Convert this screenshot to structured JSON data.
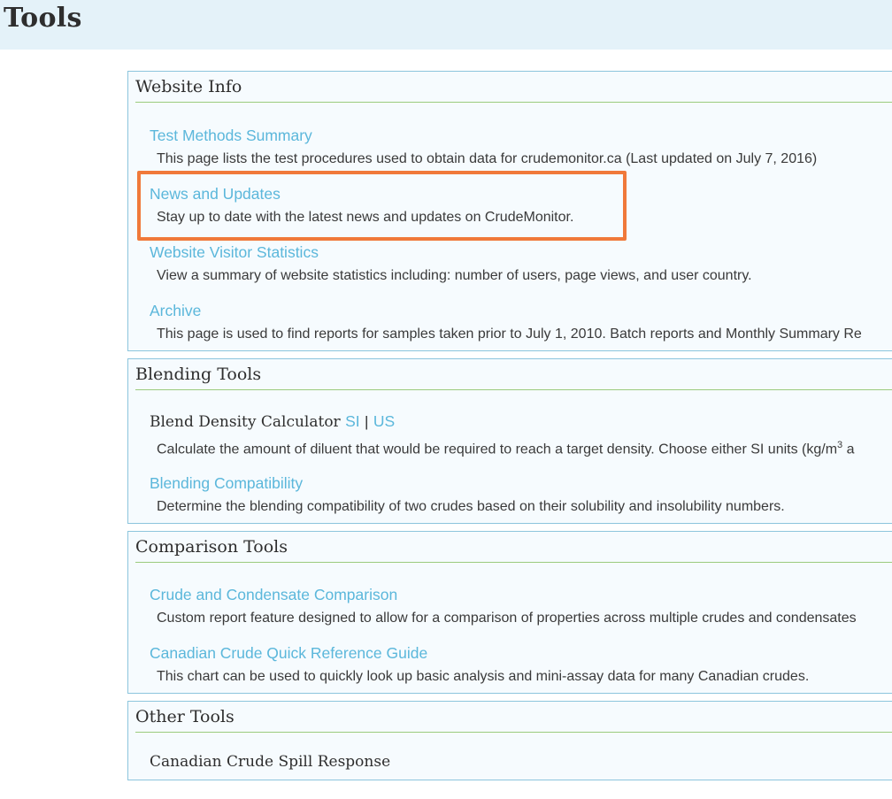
{
  "page": {
    "title": "Tools"
  },
  "sections": {
    "website_info": {
      "heading": "Website Info",
      "items": [
        {
          "link": "Test Methods Summary",
          "description": "This page lists the test procedures used to obtain data for crudemonitor.ca (Last updated on July 7, 2016)"
        },
        {
          "link": "News and Updates",
          "description": "Stay up to date with the latest news and updates on CrudeMonitor."
        },
        {
          "link": "Website Visitor Statistics",
          "description": "View a summary of website statistics including: number of users, page views, and user country."
        },
        {
          "link": "Archive",
          "description": "This page is used to find reports for samples taken prior to July 1, 2010. Batch reports and Monthly Summary Re"
        }
      ]
    },
    "blending_tools": {
      "heading": "Blending Tools",
      "calculator": {
        "title": "Blend Density Calculator",
        "si_link": "SI",
        "separator": "|",
        "us_link": "US",
        "description_pre": "Calculate the amount of diluent that would be required to reach a target density. Choose either SI units (kg/m",
        "description_sup": "3",
        "description_post": " a"
      },
      "items": [
        {
          "link": "Blending Compatibility",
          "description": "Determine the blending compatibility of two crudes based on their solubility and insolubility numbers."
        }
      ]
    },
    "comparison_tools": {
      "heading": "Comparison Tools",
      "items": [
        {
          "link": "Crude and Condensate Comparison",
          "description": "Custom report feature designed to allow for a comparison of properties across multiple crudes and condensates"
        },
        {
          "link": "Canadian Crude Quick Reference Guide",
          "description": "This chart can be used to quickly look up basic analysis and mini-assay data for many Canadian crudes."
        }
      ]
    },
    "other_tools": {
      "heading": "Other Tools",
      "items": [
        {
          "link": "Canadian Crude Spill Response"
        }
      ]
    }
  },
  "colors": {
    "link": "#5bb7db",
    "header_bg": "#e4f2f9",
    "section_border": "#8cc5dd",
    "section_rule": "#9bcb7e",
    "highlight": "#f0793a"
  }
}
